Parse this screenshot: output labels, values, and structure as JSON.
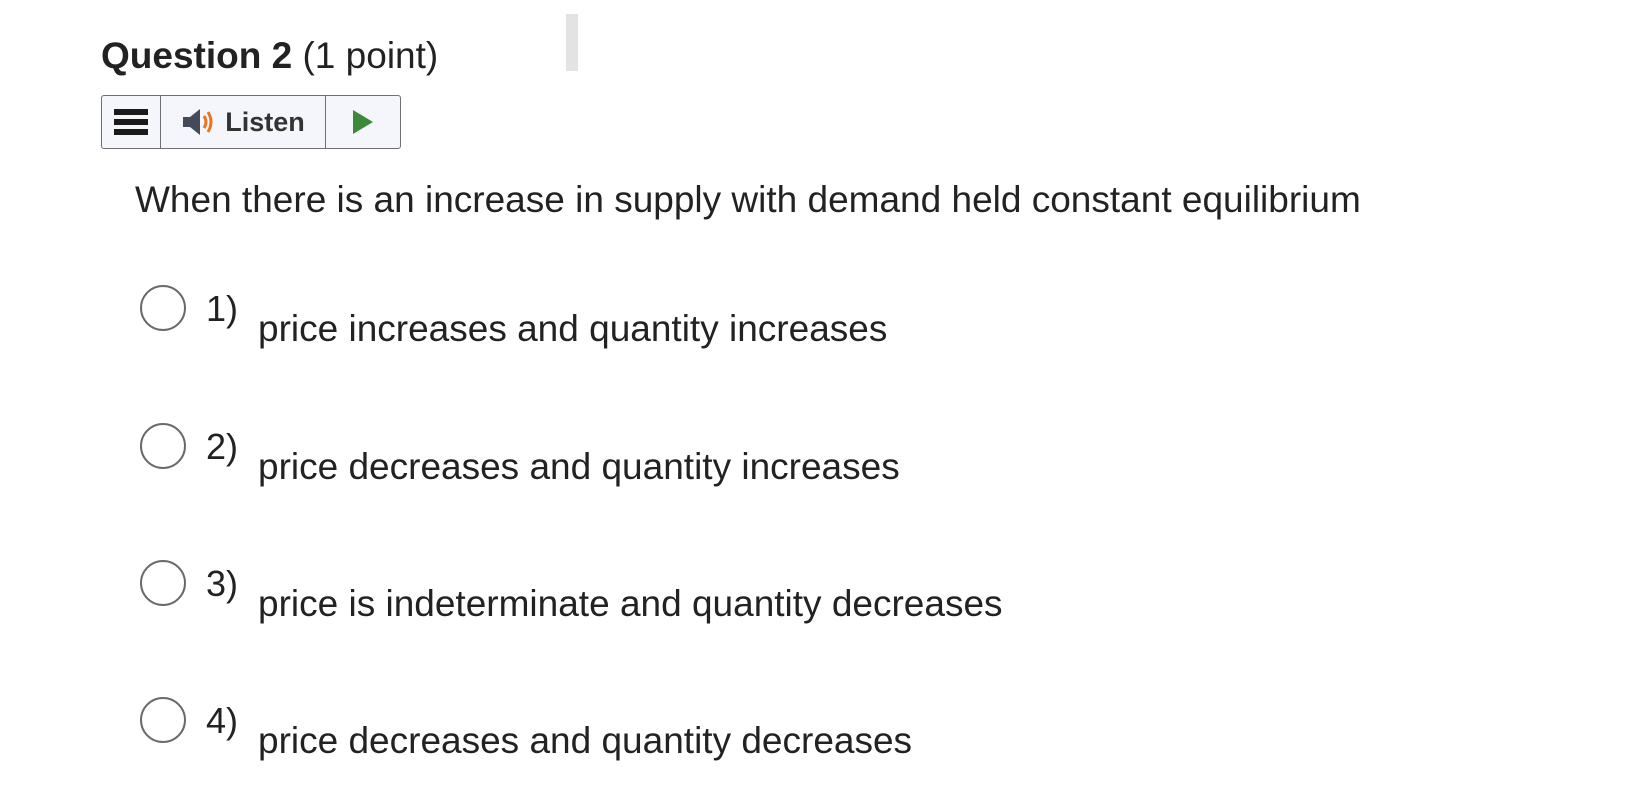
{
  "question": {
    "title": "Question 2",
    "points": "(1 point)",
    "text": "When there is an increase in supply with demand held constant equilibrium"
  },
  "toolbar": {
    "menu_icon": "hamburger-menu-icon",
    "listen_icon": "speaker-icon",
    "listen_label": "Listen",
    "play_icon": "play-icon",
    "play_color": "#3a8a3a",
    "speaker_accent": "#e87722"
  },
  "options": [
    {
      "number": "1)",
      "text": "price increases and quantity increases"
    },
    {
      "number": "2)",
      "text": "price decreases and quantity increases"
    },
    {
      "number": "3)",
      "text": "price is indeterminate and quantity decreases"
    },
    {
      "number": "4)",
      "text": "price decreases and quantity decreases"
    }
  ]
}
